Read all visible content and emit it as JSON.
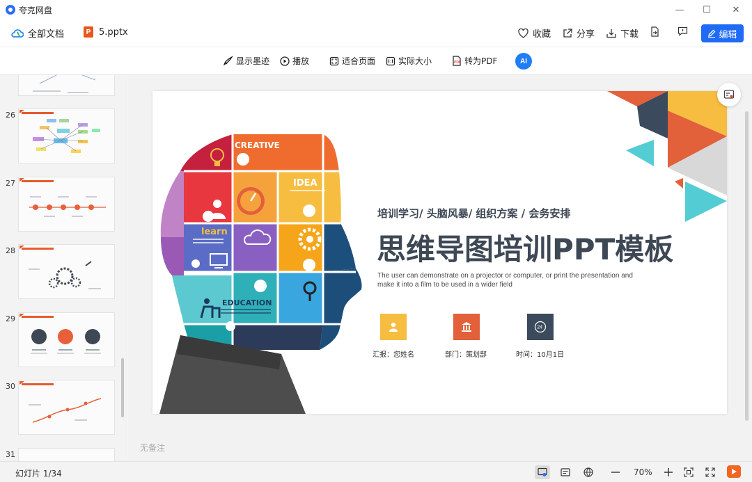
{
  "app": {
    "title": "夸克网盘"
  },
  "window": {
    "minimize": "—",
    "maximize": "☐",
    "close": "✕"
  },
  "filebar": {
    "all_docs": "全部文档",
    "filename": "5.pptx",
    "file_badge": "P",
    "favorite": "收藏",
    "share": "分享",
    "download": "下载",
    "edit": "编辑"
  },
  "toolbar": {
    "show_ink": "显示墨迹",
    "play": "播放",
    "fit_page": "适合页面",
    "actual_size": "实际大小",
    "to_pdf": "转为PDF",
    "ai_label": "AI"
  },
  "sidebar": {
    "slides": [
      {
        "number": "26"
      },
      {
        "number": "27"
      },
      {
        "number": "28"
      },
      {
        "number": "29"
      },
      {
        "number": "30"
      },
      {
        "number": "31"
      }
    ]
  },
  "slide": {
    "subtitle": "培训学习/ 头脑风暴/ 组织方案 / 会务安排",
    "title": "思维导图培训PPT模板",
    "description": "The user can demonstrate on a projector or computer, or print the presentation and make it into a film to be used in a wider field",
    "puzzle_labels": {
      "creative": "CREATIVE",
      "idea": "IDEA",
      "learn": "learn",
      "education": "EDUCATION"
    },
    "info": [
      {
        "label": "汇报：您姓名",
        "color": "#f6bd41"
      },
      {
        "label": "部门：策划部",
        "color": "#e2603a"
      },
      {
        "label": "时间：10月1日",
        "color": "#3b4a5c"
      }
    ]
  },
  "notes": {
    "placeholder": "无备注"
  },
  "status": {
    "slide_indicator": "幻灯片 1/34",
    "zoom": "70%"
  },
  "colors": {
    "accent": "#1f6bf5",
    "play": "#f26522",
    "title_text": "#3e4855"
  }
}
